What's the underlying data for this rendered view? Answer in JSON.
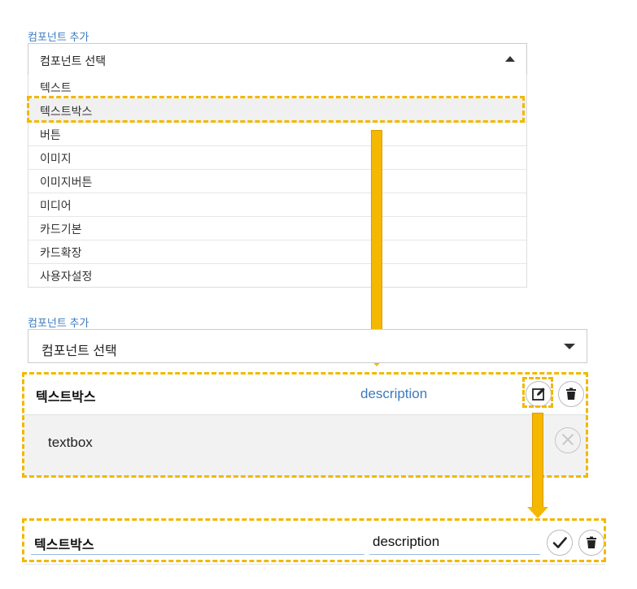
{
  "top_panel": {
    "section_label": "컴포넌트 추가",
    "select_placeholder": "컴포넌트 선택",
    "options": [
      "텍스트",
      "텍스트박스",
      "버튼",
      "이미지",
      "이미지버튼",
      "미디어",
      "카드기본",
      "카드확장",
      "사용자설정"
    ],
    "highlighted_option": "텍스트박스"
  },
  "second_panel": {
    "section_label": "컴포넌트 추가",
    "select_placeholder": "컴포넌트 선택"
  },
  "card": {
    "title": "텍스트박스",
    "description": "description",
    "body_value": "textbox",
    "icons": [
      "edit-icon",
      "trash-icon",
      "close-circle-icon"
    ]
  },
  "edit_row": {
    "title_value": "텍스트박스",
    "description_value": "description",
    "icons": [
      "check-icon",
      "trash-icon"
    ]
  },
  "colors": {
    "accent_blue": "#3b7bbf",
    "highlight_yellow": "#f2b800"
  }
}
